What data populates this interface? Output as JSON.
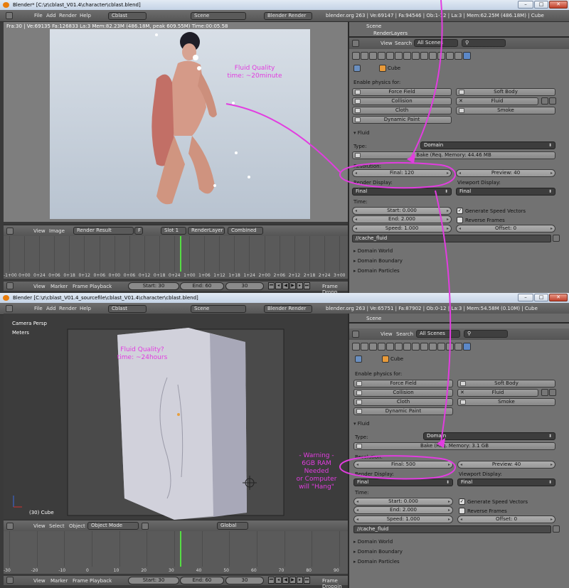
{
  "top": {
    "title": "Blender* [C:\\z\\cblast_V01.4\\character\\cblast.blend]",
    "menu": [
      "File",
      "Add",
      "Render",
      "Help"
    ],
    "screen": "Cblast",
    "scene": "Scene",
    "engine": "Blender Render",
    "stats": "blender.org 263 | Ve:69147 | Fa:94546 | Ob:1-12 | La:3 | Mem:62.25M (486.18M) | Cube",
    "render_info": "Fra:30 | Ve:69135 Fa:126833 La:3 Mem:82.23M (486.18M, peak 609.55M) Time:00:05.58",
    "image_header": {
      "items": [
        "View",
        "Image"
      ],
      "result": "Render Result",
      "f": "F",
      "slot": "Slot 1",
      "layer": "RenderLayer",
      "pass": "Combined"
    },
    "timeline_labels": [
      "-1+00",
      "0+00",
      "0+24",
      "0+06",
      "0+18",
      "0+12",
      "0+06",
      "0+00",
      "0+06",
      "0+12",
      "0+18",
      "0+24",
      "1+00",
      "1+06",
      "1+12",
      "1+18",
      "1+24",
      "2+00",
      "2+06",
      "2+12",
      "2+18",
      "2+24",
      "3+00"
    ],
    "footer": {
      "items": [
        "View",
        "Marker",
        "Frame",
        "Playback"
      ],
      "start": "Start: 30",
      "end": "End: 60",
      "frame": "30",
      "drop": "Frame Dropp"
    },
    "outliner": {
      "scene": "Scene",
      "layers": "RenderLayers"
    },
    "panel_tool": {
      "view": "View",
      "search": "Search",
      "scenes": "All Scenes"
    },
    "object": "Cube",
    "physics_label": "Enable physics for:",
    "physics": {
      "force_field": "Force Field",
      "soft_body": "Soft Body",
      "collision": "Collision",
      "fluid": "Fluid",
      "cloth": "Cloth",
      "smoke": "Smoke",
      "dynamic_paint": "Dynamic Paint"
    },
    "fluid": {
      "header": "Fluid",
      "type_label": "Type:",
      "type": "Domain",
      "bake": "Bake (Req. Memory: 44.46 MB",
      "resolution_label": "Resolution:",
      "final": "Final: 120",
      "preview": "Preview: 40",
      "render_display_label": "Render Display:",
      "viewport_display_label": "Viewport Display:",
      "render_display": "Final",
      "viewport_display": "Final",
      "time_label": "Time:",
      "start": "Start: 0.000",
      "end": "End: 2.000",
      "speed": "Speed: 1.000",
      "gen_speed": "Generate Speed Vectors",
      "reverse": "Reverse Frames",
      "offset": "Offset: 0",
      "cache": "//cache_fluid",
      "world": "Domain World",
      "boundary": "Domain Boundary",
      "particles": "Domain Particles"
    },
    "annotation": "Fluid Quality\ntime: ~20minute"
  },
  "bottom": {
    "title": "Blender [C:\\z\\cblast_V01.4_sourcefile\\cblast_V01.4\\character\\cblast.blend]",
    "menu": [
      "File",
      "Add",
      "Render",
      "Help"
    ],
    "screen": "Cblast",
    "scene": "Scene",
    "engine": "Blender Render",
    "stats": "blender.org 263 | Ve:65751 | Fa:87902 | Ob:0-12 | La:3 | Mem:54.58M (0.10M) | Cube",
    "camera_label": "Camera Persp",
    "units_label": "Meters",
    "object_label": "(30) Cube",
    "view_header": {
      "items": [
        "View",
        "Select",
        "Object"
      ],
      "mode": "Object Mode",
      "orient": "Global"
    },
    "timeline_labels": [
      "-30",
      "-20",
      "-10",
      "0",
      "10",
      "20",
      "30",
      "40",
      "50",
      "60",
      "70",
      "80",
      "90"
    ],
    "footer": {
      "items": [
        "View",
        "Marker",
        "Frame",
        "Playback"
      ],
      "start": "Start: 30",
      "end": "End: 60",
      "frame": "30",
      "drop": "Frame Droppin"
    },
    "outliner": {
      "scene": "Scene"
    },
    "panel_tool": {
      "view": "View",
      "search": "Search",
      "scenes": "All Scenes"
    },
    "object": "Cube",
    "physics_label": "Enable physics for:",
    "physics": {
      "force_field": "Force Field",
      "soft_body": "Soft Body",
      "collision": "Collision",
      "fluid": "Fluid",
      "cloth": "Cloth",
      "smoke": "Smoke",
      "dynamic_paint": "Dynamic Paint"
    },
    "fluid": {
      "header": "Fluid",
      "type_label": "Type:",
      "type": "Domain",
      "bake": "Bake (Req. Memory: 3.1 GB",
      "resolution_label": "Resolution:",
      "final": "Final: 500",
      "preview": "Preview: 40",
      "render_display_label": "Render Display:",
      "viewport_display_label": "Viewport Display:",
      "render_display": "Final",
      "viewport_display": "Final",
      "time_label": "Time:",
      "start": "Start: 0.000",
      "end": "End: 2.000",
      "speed": "Speed: 1.000",
      "gen_speed": "Generate Speed Vectors",
      "reverse": "Reverse Frames",
      "offset": "Offset: 0",
      "cache": "//cache_fluid",
      "world": "Domain World",
      "boundary": "Domain Boundary",
      "particles": "Domain Particles"
    },
    "annotation": "Fluid Quality?\ntime: ~24hours",
    "warning": "- Warning -\n6GB RAM\nNeeded\nor Computer\nwill \"Hang\""
  },
  "colors": {
    "annotation": "#e23de0",
    "active_tab": "#5c88c8",
    "frame_cursor": "#55dd44"
  }
}
